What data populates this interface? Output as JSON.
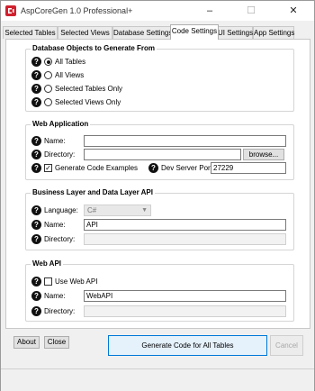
{
  "window": {
    "title": "AspCoreGen 1.0 Professional+",
    "minimize_glyph": "–",
    "maximize_glyph": "☐",
    "close_glyph": "✕"
  },
  "tabs": [
    {
      "label": "Selected Tables",
      "active": false
    },
    {
      "label": "Selected Views",
      "active": false
    },
    {
      "label": "Database Settings",
      "active": false
    },
    {
      "label": "Code Settings",
      "active": true
    },
    {
      "label": "UI Settings",
      "active": false
    },
    {
      "label": "App Settings",
      "active": false
    }
  ],
  "help_glyph": "?",
  "db_objects": {
    "legend": "Database Objects to Generate From",
    "options": [
      {
        "label": "All Tables",
        "selected": true
      },
      {
        "label": "All Views",
        "selected": false
      },
      {
        "label": "Selected Tables Only",
        "selected": false
      },
      {
        "label": "Selected Views Only",
        "selected": false
      }
    ]
  },
  "web_app": {
    "legend": "Web Application",
    "name_label": "Name:",
    "name_value": "",
    "directory_label": "Directory:",
    "directory_value": "",
    "browse_label": "browse...",
    "generate_examples_label": "Generate Code Examples",
    "generate_examples_checked": true,
    "dev_port_label": "Dev Server Port:",
    "dev_port_value": "27229"
  },
  "business_layer": {
    "legend": "Business Layer and Data Layer API",
    "language_label": "Language:",
    "language_value": "C#",
    "name_label": "Name:",
    "name_value": "API",
    "directory_label": "Directory:",
    "directory_value": ""
  },
  "web_api": {
    "legend": "Web API",
    "use_label": "Use Web API",
    "use_checked": false,
    "name_label": "Name:",
    "name_value": "WebAPI",
    "directory_label": "Directory:",
    "directory_value": ""
  },
  "footer": {
    "about_label": "About",
    "close_label": "Close",
    "generate_label": "Generate Code for All Tables",
    "cancel_label": "Cancel"
  }
}
